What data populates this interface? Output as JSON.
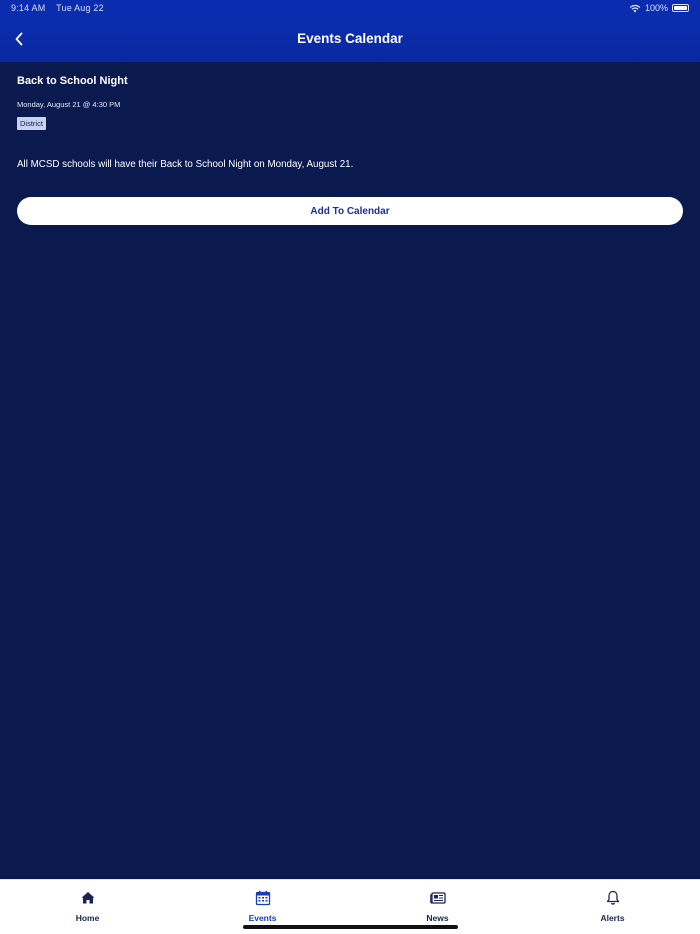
{
  "status_bar": {
    "time": "9:14 AM",
    "date": "Tue Aug 22",
    "battery_percent": "100%"
  },
  "header": {
    "title": "Events Calendar",
    "back_icon": "chevron-left-icon"
  },
  "event": {
    "title": "Back to School Night",
    "datetime": "Monday, August 21 @ 4:30 PM",
    "tag": "District",
    "description": "All MCSD schools will have their Back to School Night on Monday, August 21."
  },
  "actions": {
    "add_to_calendar_label": "Add To Calendar"
  },
  "tab_bar": {
    "active": "Events",
    "tabs": [
      {
        "label": "Home",
        "icon": "home-icon"
      },
      {
        "label": "Events",
        "icon": "calendar-icon"
      },
      {
        "label": "News",
        "icon": "newspaper-icon"
      },
      {
        "label": "Alerts",
        "icon": "bell-icon"
      }
    ]
  },
  "colors": {
    "header_blue": "#0a2db0",
    "background_navy": "#0a1a4f",
    "tag_background": "#c9d3f0",
    "button_text": "#1b2e9a",
    "active_tab": "#1b3ac0"
  }
}
